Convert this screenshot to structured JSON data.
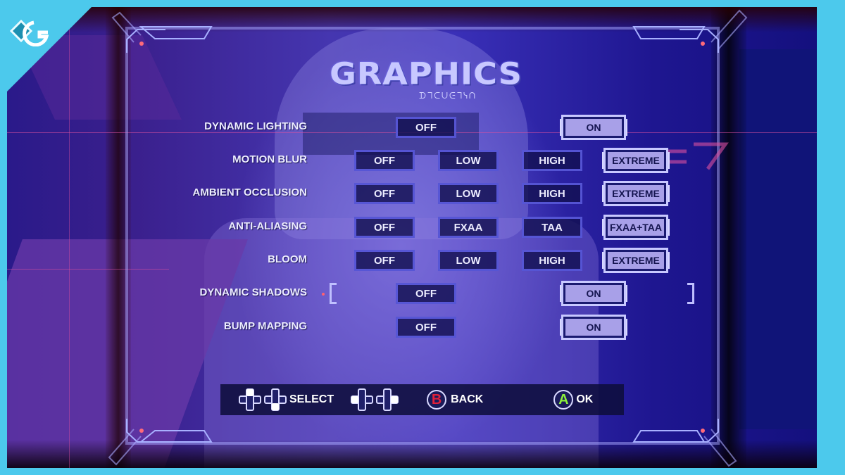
{
  "site_logo": "G",
  "screen": {
    "title": "GRAPHICS",
    "subtitle_glyphs": "ᗪᒣᑕᑌᕮᒣᓭᑎ",
    "settings": [
      {
        "label": "DYNAMIC LIGHTING",
        "options": [
          "OFF",
          "ON"
        ],
        "selected": "ON",
        "bracketed": false
      },
      {
        "label": "MOTION BLUR",
        "options": [
          "OFF",
          "LOW",
          "HIGH",
          "EXTREME"
        ],
        "selected": "EXTREME",
        "bracketed": false
      },
      {
        "label": "AMBIENT OCCLUSION",
        "options": [
          "OFF",
          "LOW",
          "HIGH",
          "EXTREME"
        ],
        "selected": "EXTREME",
        "bracketed": false
      },
      {
        "label": "ANTI-ALIASING",
        "options": [
          "OFF",
          "FXAA",
          "TAA",
          "FXAA+TAA"
        ],
        "selected": "FXAA+TAA",
        "bracketed": false
      },
      {
        "label": "BLOOM",
        "options": [
          "OFF",
          "LOW",
          "HIGH",
          "EXTREME"
        ],
        "selected": "EXTREME",
        "bracketed": false
      },
      {
        "label": "DYNAMIC SHADOWS",
        "options": [
          "OFF",
          "ON"
        ],
        "selected": "ON",
        "bracketed": true
      },
      {
        "label": "BUMP MAPPING",
        "options": [
          "OFF",
          "ON"
        ],
        "selected": "ON",
        "bracketed": false
      }
    ],
    "footer": {
      "select_label": "SELECT",
      "back_button": "B",
      "back_label": "BACK",
      "ok_button": "A",
      "ok_label": "OK"
    }
  },
  "colors": {
    "border": "#4cc9ec",
    "b_button": "#e0203a",
    "a_button": "#8cf03c",
    "selected_fill": "#a8a0e8"
  }
}
